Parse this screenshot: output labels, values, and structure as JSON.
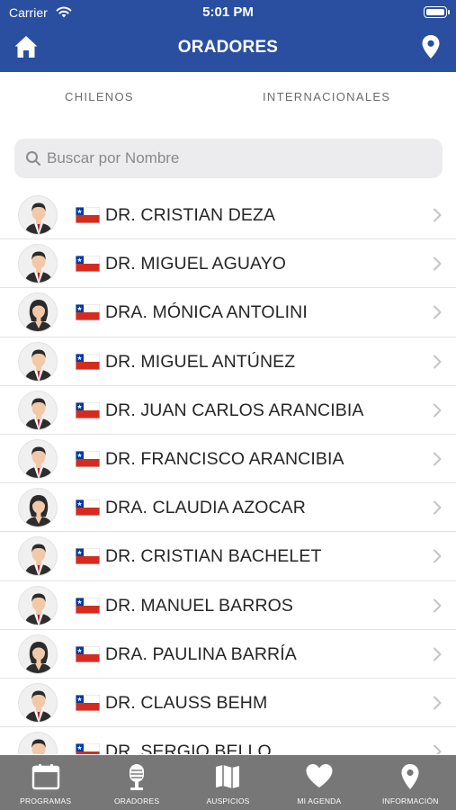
{
  "status_bar": {
    "carrier": "Carrier",
    "time": "5:01 PM"
  },
  "nav": {
    "title": "ORADORES",
    "left_icon": "home-icon",
    "right_icon": "location-pin-icon"
  },
  "segments": {
    "left": "CHILENOS",
    "right": "INTERNACIONALES"
  },
  "search": {
    "placeholder": "Buscar por Nombre",
    "value": ""
  },
  "speakers": [
    {
      "name": "DR. CRISTIAN DEZA",
      "gender": "male",
      "flag": "chile"
    },
    {
      "name": "DR. MIGUEL AGUAYO",
      "gender": "male",
      "flag": "chile"
    },
    {
      "name": "DRA. MÓNICA ANTOLINI",
      "gender": "female",
      "flag": "chile"
    },
    {
      "name": "DR. MIGUEL ANTÚNEZ",
      "gender": "male",
      "flag": "chile"
    },
    {
      "name": "DR. JUAN CARLOS ARANCIBIA",
      "gender": "male",
      "flag": "chile"
    },
    {
      "name": "DR. FRANCISCO ARANCIBIA",
      "gender": "male",
      "flag": "chile"
    },
    {
      "name": "DRA. CLAUDIA AZOCAR",
      "gender": "female",
      "flag": "chile"
    },
    {
      "name": "DR. CRISTIAN BACHELET",
      "gender": "male",
      "flag": "chile"
    },
    {
      "name": "DR. MANUEL BARROS",
      "gender": "male",
      "flag": "chile"
    },
    {
      "name": "DRA. PAULINA BARRÍA",
      "gender": "female",
      "flag": "chile"
    },
    {
      "name": "DR. CLAUSS BEHM",
      "gender": "male",
      "flag": "chile"
    },
    {
      "name": "DR. SERGIO BELLO",
      "gender": "male",
      "flag": "chile"
    }
  ],
  "tabbar": [
    {
      "label": "PROGRAMAS",
      "icon": "calendar-icon"
    },
    {
      "label": "ORADORES",
      "icon": "microphone-icon"
    },
    {
      "label": "AUSPICIOS",
      "icon": "map-icon"
    },
    {
      "label": "MI AGENDA",
      "icon": "heart-icon"
    },
    {
      "label": "INFORMACIÓN",
      "icon": "location-pin-icon"
    }
  ],
  "colors": {
    "header": "#2a4ea0",
    "tabbar": "#777777",
    "flag_red": "#d52b1e",
    "flag_blue": "#0039a6"
  }
}
